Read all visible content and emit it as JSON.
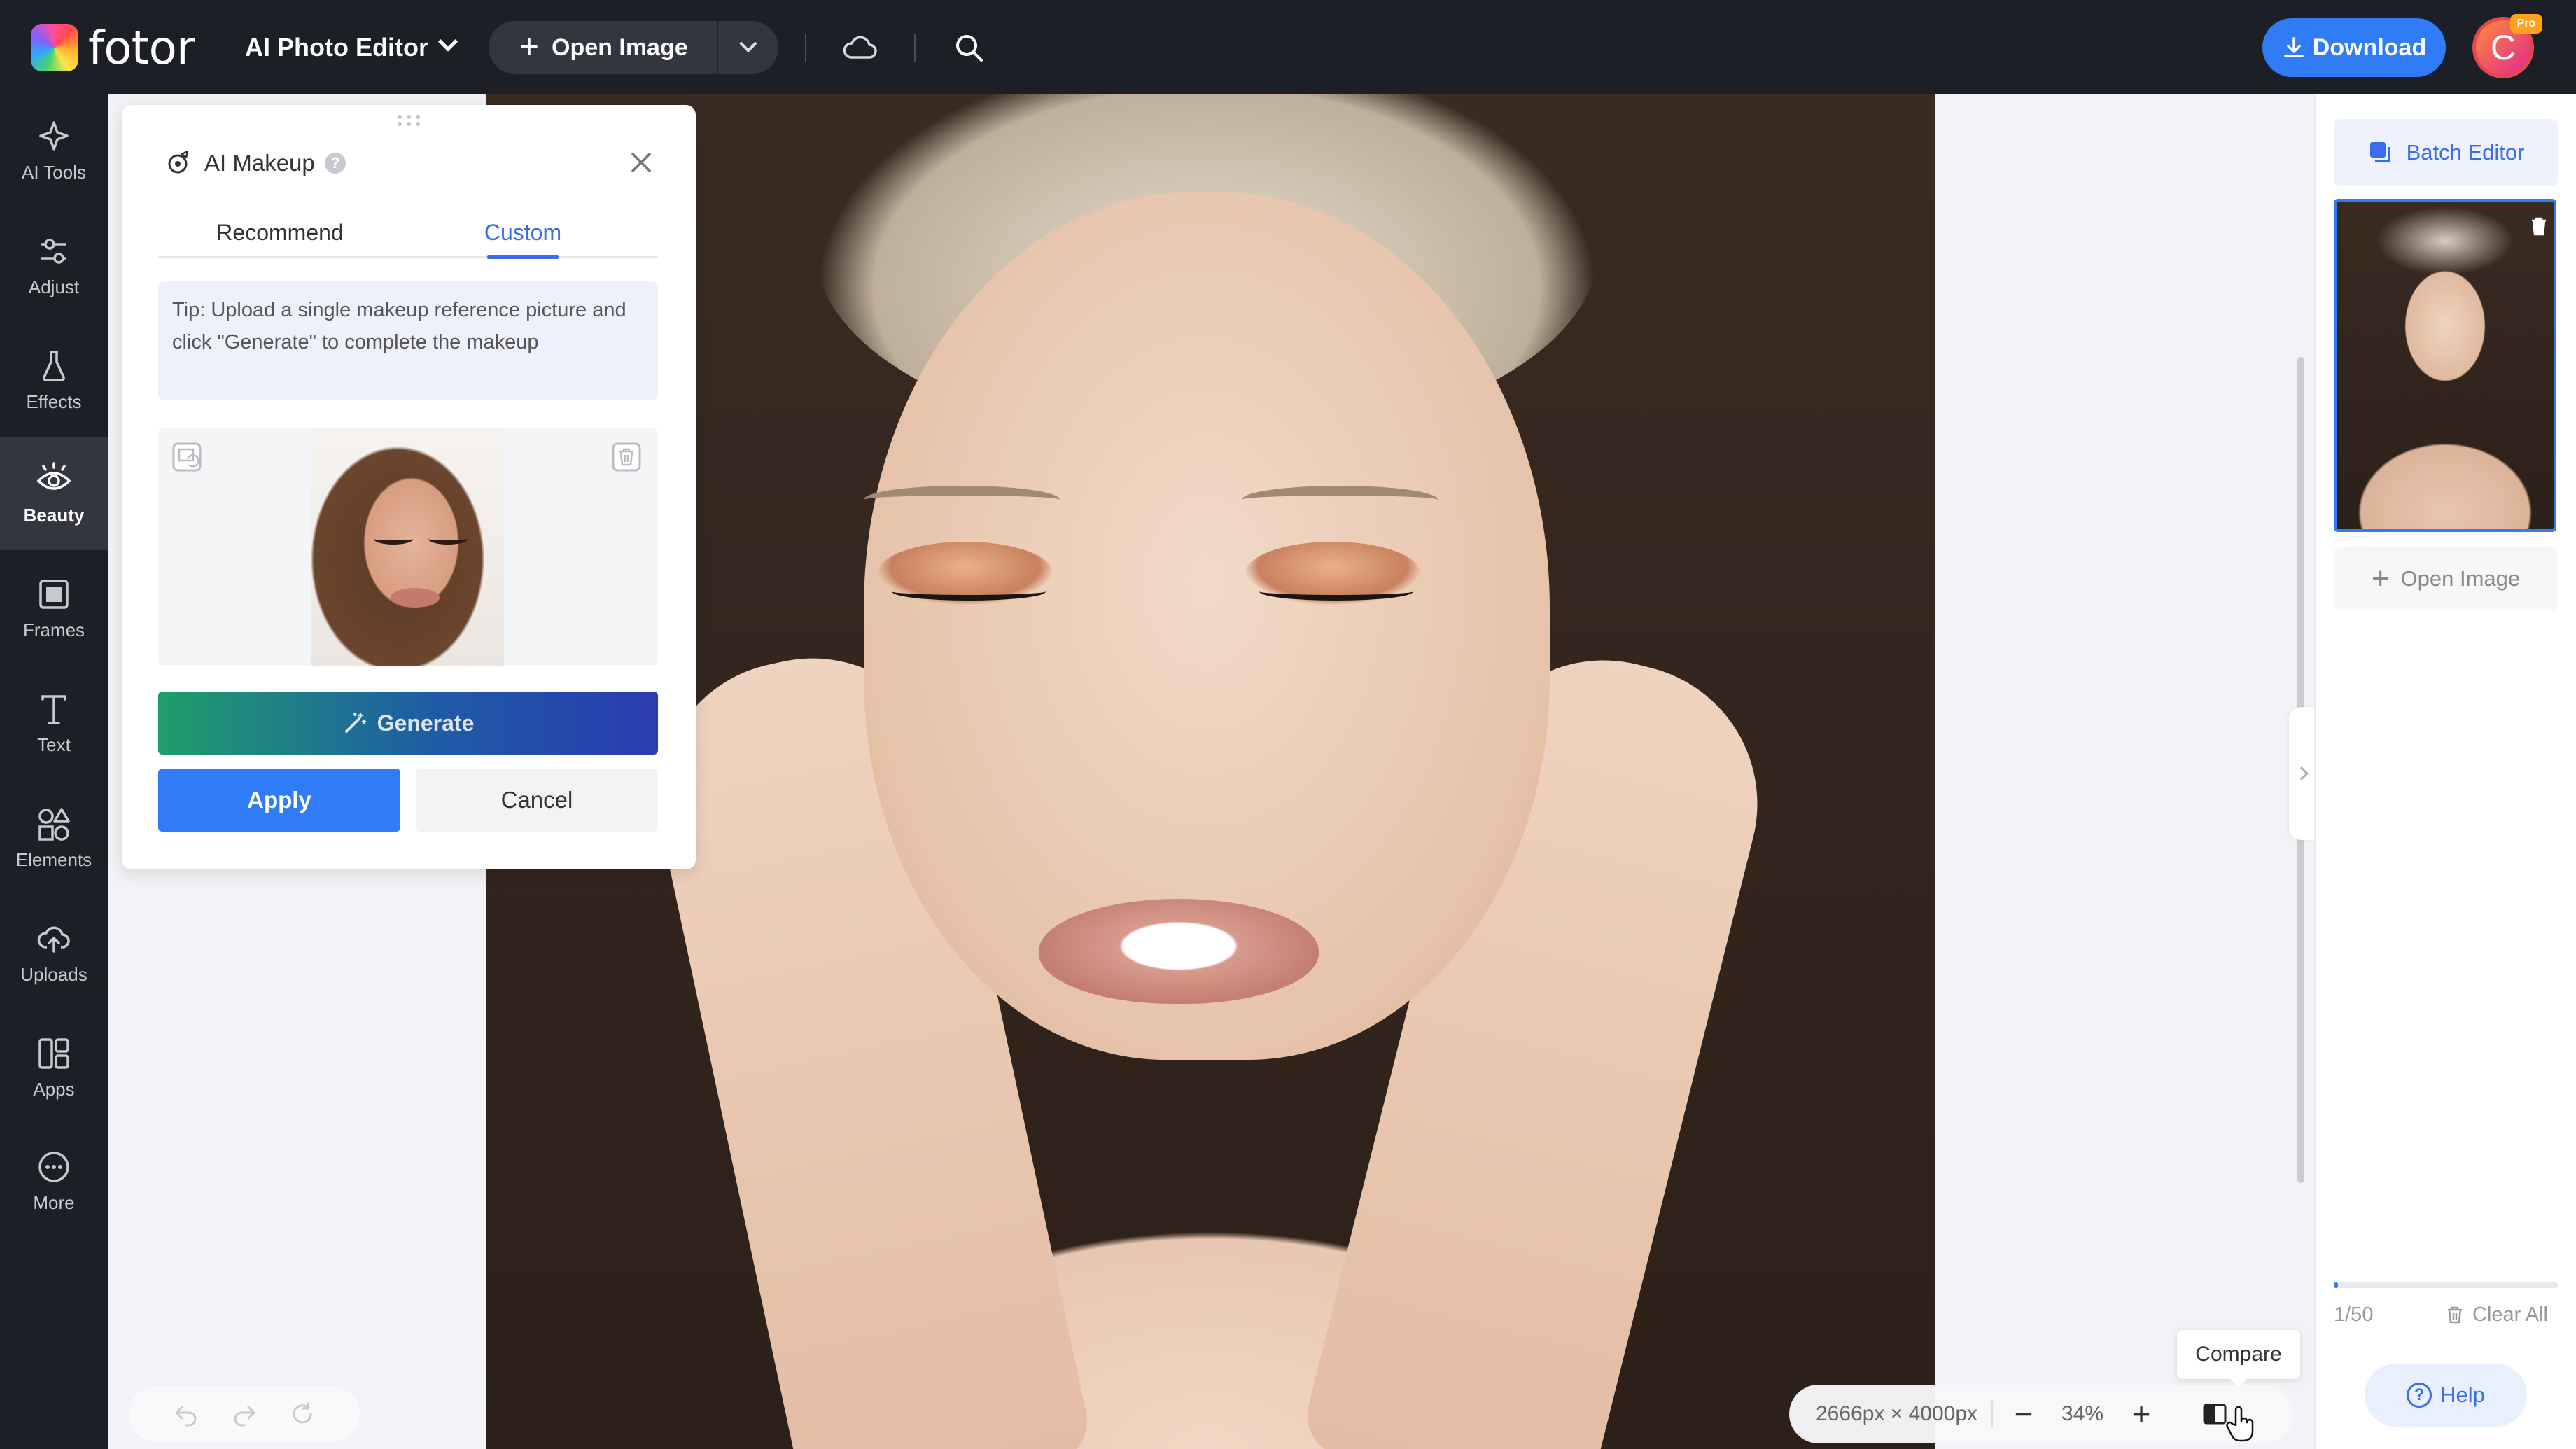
{
  "brand": {
    "logo_text": "fotor"
  },
  "topbar": {
    "app_menu_label": "AI Photo Editor",
    "open_image_label": "Open Image",
    "download_label": "Download",
    "avatar_initial": "C",
    "pro_badge": "Pro"
  },
  "rail": {
    "items": [
      {
        "label": "AI Tools",
        "icon": "sparkle-icon"
      },
      {
        "label": "Adjust",
        "icon": "sliders-icon"
      },
      {
        "label": "Effects",
        "icon": "flask-icon"
      },
      {
        "label": "Beauty",
        "icon": "eye-icon",
        "active": true
      },
      {
        "label": "Frames",
        "icon": "frame-icon"
      },
      {
        "label": "Text",
        "icon": "text-icon"
      },
      {
        "label": "Elements",
        "icon": "shapes-icon"
      },
      {
        "label": "Uploads",
        "icon": "cloud-upload-icon"
      },
      {
        "label": "Apps",
        "icon": "apps-icon"
      },
      {
        "label": "More",
        "icon": "more-icon"
      }
    ]
  },
  "panel": {
    "title": "AI Makeup",
    "help": "?",
    "tabs": [
      {
        "label": "Recommend",
        "active": false
      },
      {
        "label": "Custom",
        "active": true
      }
    ],
    "tip": "Tip: Upload a single makeup reference picture and click \"Generate\" to complete the makeup",
    "generate_label": "Generate",
    "apply_label": "Apply",
    "cancel_label": "Cancel"
  },
  "canvas": {
    "dimensions": "2666px × 4000px",
    "zoom": "34%",
    "zoom_out": "−",
    "zoom_in": "+",
    "compare_tooltip": "Compare"
  },
  "right_panel": {
    "batch_editor_label": "Batch Editor",
    "open_image_label": "Open Image",
    "count": "1/50",
    "count_fraction": 0.02,
    "clear_all_label": "Clear All",
    "help_label": "Help"
  },
  "colors": {
    "accent": "#2f7cf6",
    "tab_active": "#3b6cf0",
    "topbar_bg": "#1d1f27"
  }
}
